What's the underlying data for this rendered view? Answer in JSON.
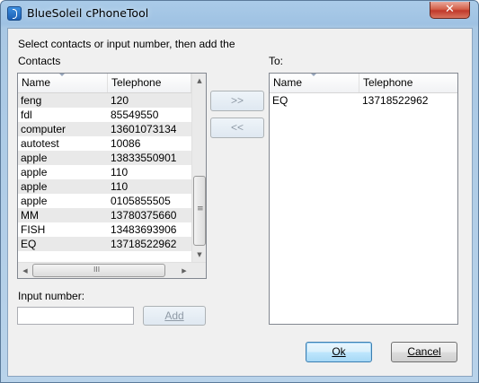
{
  "window": {
    "title": "BlueSoleil cPhoneTool",
    "close_glyph": "✕"
  },
  "instructions": {
    "line1": "Select contacts or input number, then add the",
    "line2": "Contacts"
  },
  "contacts": {
    "columns": [
      "Name",
      "Telephone"
    ],
    "rows": [
      {
        "name": "feng",
        "phone": "120"
      },
      {
        "name": "fdl",
        "phone": "85549550"
      },
      {
        "name": "computer",
        "phone": "13601073134"
      },
      {
        "name": "autotest",
        "phone": "10086"
      },
      {
        "name": "apple",
        "phone": "13833550901"
      },
      {
        "name": "apple",
        "phone": "110"
      },
      {
        "name": "apple",
        "phone": "110"
      },
      {
        "name": "apple",
        "phone": "0105855505"
      },
      {
        "name": "MM",
        "phone": "13780375660"
      },
      {
        "name": "FISH",
        "phone": "13483693906"
      },
      {
        "name": "EQ",
        "phone": "13718522962"
      }
    ],
    "hscroll_grip": "III",
    "vscroll_grip": "≡"
  },
  "transfer": {
    "add_label": ">>",
    "remove_label": "<<"
  },
  "to": {
    "label": "To:",
    "columns": [
      "Name",
      "Telephone"
    ],
    "rows": [
      {
        "name": "EQ",
        "phone": "13718522962"
      }
    ]
  },
  "input_number": {
    "label": "Input number:",
    "value": "",
    "add_button_label": "Add"
  },
  "dialog_buttons": {
    "ok_label": "Ok",
    "cancel_label": "Cancel"
  },
  "icons": {
    "app": "bluesoleil-app-icon",
    "close": "close-icon",
    "scroll_up": "▲",
    "scroll_down": "▼",
    "scroll_left": "◀",
    "scroll_right": "▶"
  }
}
